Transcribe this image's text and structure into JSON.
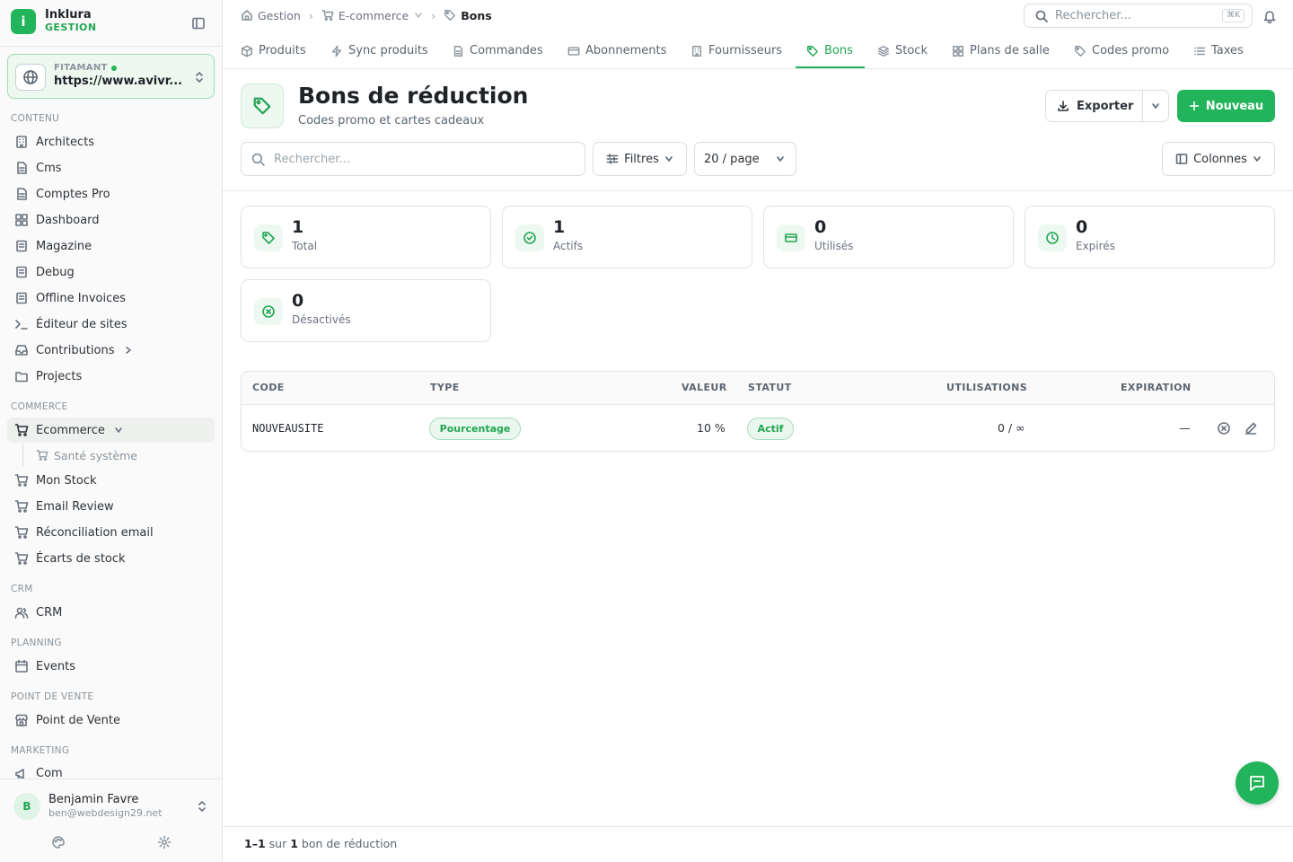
{
  "brand": {
    "name": "Inklura",
    "sub": "GESTION",
    "logo_letter": "i"
  },
  "site": {
    "label": "FITAMANT",
    "url": "https://www.avivr..."
  },
  "sidebar": {
    "sections": [
      "CONTENU",
      "COMMERCE",
      "CRM",
      "PLANNING",
      "POINT DE VENTE",
      "MARKETING"
    ],
    "contenu": [
      "Architects",
      "Cms",
      "Comptes Pro",
      "Dashboard",
      "Magazine",
      "Debug",
      "Offline Invoices",
      "Éditeur de sites",
      "Contributions",
      "Projects"
    ],
    "commerce": {
      "active": "Ecommerce",
      "sub": "Santé système",
      "items": [
        "Mon Stock",
        "Email Review",
        "Réconciliation email",
        "Écarts de stock"
      ]
    },
    "crm": [
      "CRM"
    ],
    "planning": [
      "Events"
    ],
    "pos": [
      "Point de Vente"
    ],
    "marketing": [
      "Com"
    ]
  },
  "user": {
    "initial": "B",
    "name": "Benjamin Favre",
    "email": "ben@webdesign29.net"
  },
  "breadcrumb": {
    "home": "Gestion",
    "section": "E-commerce",
    "current": "Bons"
  },
  "top_search": {
    "placeholder": "Rechercher...",
    "shortcut": "⌘K"
  },
  "tabs": [
    "Produits",
    "Sync produits",
    "Commandes",
    "Abonnements",
    "Fournisseurs",
    "Bons",
    "Stock",
    "Plans de salle",
    "Codes promo",
    "Taxes"
  ],
  "active_tab": "Bons",
  "page": {
    "title": "Bons de réduction",
    "subtitle": "Codes promo et cartes cadeaux",
    "export_label": "Exporter",
    "new_label": "Nouveau"
  },
  "toolbar": {
    "search_placeholder": "Rechercher...",
    "filters_label": "Filtres",
    "per_page": "20 / page",
    "columns_label": "Colonnes"
  },
  "stats": [
    {
      "value": "1",
      "label": "Total",
      "icon": "tag-icon"
    },
    {
      "value": "1",
      "label": "Actifs",
      "icon": "check-circle-icon"
    },
    {
      "value": "0",
      "label": "Utilisés",
      "icon": "card-icon"
    },
    {
      "value": "0",
      "label": "Expirés",
      "icon": "clock-icon"
    },
    {
      "value": "0",
      "label": "Désactivés",
      "icon": "x-circle-icon"
    }
  ],
  "table": {
    "headers": [
      "CODE",
      "TYPE",
      "VALEUR",
      "STATUT",
      "UTILISATIONS",
      "EXPIRATION"
    ],
    "rows": [
      {
        "code": "NOUVEAUSITE",
        "type": "Pourcentage",
        "value": "10 %",
        "status": "Actif",
        "uses": "0 / ∞",
        "expiration": "—"
      }
    ]
  },
  "footer": {
    "range": "1–1",
    "sur": "sur",
    "total": "1",
    "suffix": "bon de réduction"
  },
  "colors": {
    "accent": "#22b45a",
    "accent_dark": "#22a652",
    "accent_bg": "#ecf8f0"
  }
}
